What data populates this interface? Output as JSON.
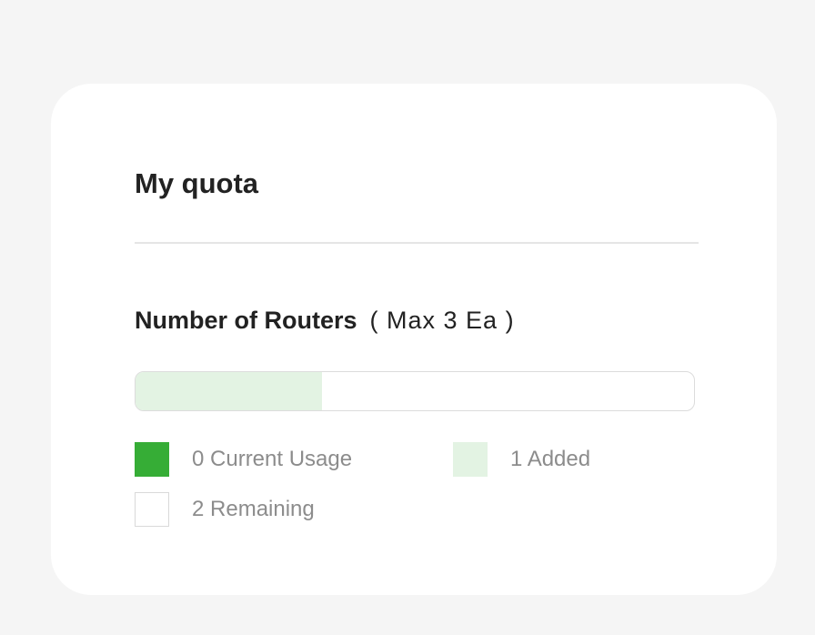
{
  "quota": {
    "title": "My quota",
    "section_label": "Number of Routers",
    "max_label": "( Max 3 Ea )",
    "max": 3,
    "current_usage": 0,
    "added": 1,
    "remaining": 2,
    "legend": {
      "current_usage": "0 Current Usage",
      "added": "1 Added",
      "remaining": "2 Remaining"
    }
  },
  "colors": {
    "page_background": "#f5f5f5",
    "card_background": "#ffffff",
    "current_usage": "#36ad36",
    "added": "#e3f3e3",
    "remaining": "#ffffff",
    "remaining_border": "#d9d9d9",
    "bar_border": "#dcdcdc"
  }
}
